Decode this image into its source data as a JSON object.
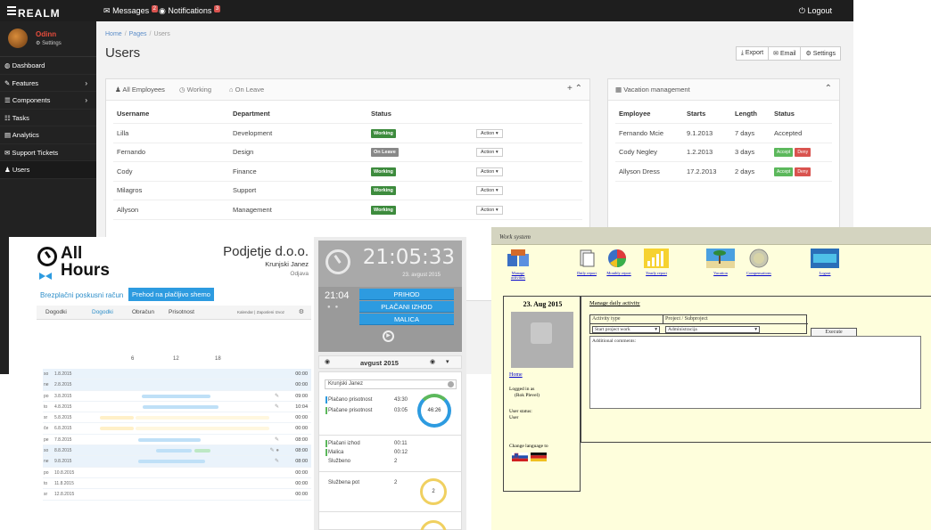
{
  "realm": {
    "brand": "REALM",
    "topbar": {
      "messages_label": "Messages",
      "messages_count": "2",
      "notifications_label": "Notifications",
      "notifications_count": "3",
      "logout_label": "Logout"
    },
    "user": {
      "name": "Odinn",
      "settings_label": "Settings"
    },
    "sidebar": [
      {
        "label": "Dashboard",
        "icon": "dashboard-icon",
        "has_children": false
      },
      {
        "label": "Features",
        "icon": "magic-icon",
        "has_children": true
      },
      {
        "label": "Components",
        "icon": "list-icon",
        "has_children": true
      },
      {
        "label": "Tasks",
        "icon": "tasks-icon",
        "has_children": false
      },
      {
        "label": "Analytics",
        "icon": "chart-icon",
        "has_children": false
      },
      {
        "label": "Support Tickets",
        "icon": "ticket-icon",
        "has_children": false
      },
      {
        "label": "Users",
        "icon": "user-icon",
        "has_children": false,
        "active": true
      }
    ],
    "breadcrumb": [
      "Home",
      "Pages",
      "Users"
    ],
    "page_title": "Users",
    "actions": {
      "export": "Export",
      "email": "Email",
      "settings": "Settings"
    },
    "employees_panel": {
      "tabs": [
        "All Employees",
        "Working",
        "On Leave"
      ],
      "columns": [
        "Username",
        "Department",
        "Status"
      ],
      "action_label": "Action",
      "rows": [
        {
          "username": "Lilla",
          "department": "Development",
          "status": "Working"
        },
        {
          "username": "Fernando",
          "department": "Design",
          "status": "On Leave"
        },
        {
          "username": "Cody",
          "department": "Finance",
          "status": "Working"
        },
        {
          "username": "Milagros",
          "department": "Support",
          "status": "Working"
        },
        {
          "username": "Allyson",
          "department": "Management",
          "status": "Working"
        }
      ]
    },
    "vacation_panel": {
      "title": "Vacation management",
      "columns": [
        "Employee",
        "Starts",
        "Length",
        "Status"
      ],
      "accept_label": "Accept",
      "deny_label": "Deny",
      "rows": [
        {
          "employee": "Fernando Mcie",
          "starts": "9.1.2013",
          "length": "7 days",
          "status": "Accepted"
        },
        {
          "employee": "Cody Negley",
          "starts": "1.2.2013",
          "length": "3 days",
          "status": ""
        },
        {
          "employee": "Allyson Dress",
          "starts": "17.2.2013",
          "length": "2 days",
          "status": ""
        }
      ]
    },
    "colors": {
      "topbar": "#1e1e1e",
      "sidebar": "#222222",
      "working": "#3d8b3d",
      "onleave": "#888888",
      "accept": "#5cb85c",
      "deny": "#d9534f",
      "link": "#5b8dc9"
    }
  },
  "allhours": {
    "logo_line1": "All",
    "logo_line2": "Hours",
    "company": "Podjetje d.o.o.",
    "person": "Krunjski Janez",
    "location": "Odjava",
    "trial_text": "Brezplačni poskusni račun",
    "trial_button": "Prehod na plačljivo shemo",
    "tabs": [
      "Dogodki",
      "Dogodki",
      "Obračun",
      "Prisotnost"
    ],
    "tab_tools": "Kalendar | Zaposleni Izvoz",
    "ruler": [
      "6",
      "12",
      "18"
    ],
    "days": [
      {
        "d": "so",
        "date": "1.8.2015",
        "time": "00:00",
        "hl": true
      },
      {
        "d": "ne",
        "date": "2.8.2015",
        "time": "00:00",
        "hl": true
      },
      {
        "d": "po",
        "date": "3.8.2015",
        "time": "09:00",
        "hl": false
      },
      {
        "d": "to",
        "date": "4.8.2015",
        "time": "10:04",
        "hl": false
      },
      {
        "d": "sr",
        "date": "5.8.2015",
        "time": "00:00",
        "hl": false
      },
      {
        "d": "če",
        "date": "6.8.2015",
        "time": "00:00",
        "hl": false
      },
      {
        "d": "pe",
        "date": "7.8.2015",
        "time": "08:00",
        "hl": false
      },
      {
        "d": "so",
        "date": "8.8.2015",
        "time": "08:00",
        "hl": true
      },
      {
        "d": "ne",
        "date": "9.8.2015",
        "time": "08:00",
        "hl": true
      },
      {
        "d": "po",
        "date": "10.8.2015",
        "time": "00:00",
        "hl": false
      },
      {
        "d": "to",
        "date": "11.8.2015",
        "time": "00:00",
        "hl": false
      },
      {
        "d": "sr",
        "date": "12.8.2015",
        "time": "00:00",
        "hl": false
      }
    ],
    "clock": {
      "time": "21:05:33",
      "date": "23. avgust 2015",
      "small_time": "21:04"
    },
    "status_buttons": [
      "PRIHOD",
      "PLAČANI IZHOD",
      "MALICA"
    ],
    "calendar_month": "avgust 2015",
    "stats": {
      "employee": "Krunjski Janez",
      "lines": [
        {
          "label": "Plačano prisotnost",
          "value": "43:30",
          "color": "#2d9be0"
        },
        {
          "label": "Plačane prisotnost",
          "value": "03:05",
          "color": "#5cb85c"
        },
        {
          "label": "Plačani izhod",
          "value": "00:11",
          "color": "#5cb85c"
        },
        {
          "label": "Malica",
          "value": "00:12",
          "color": "#5cb85c"
        },
        {
          "label": "Službeno",
          "value": "2",
          "color": "#ffffff"
        },
        {
          "label": "Službena pot",
          "value": "2",
          "color": "#f0c040"
        }
      ],
      "ring_total": "46:26",
      "ring_small": "2"
    },
    "colors": {
      "accent": "#2d9be0",
      "panel": "#a9a9a9"
    }
  },
  "work": {
    "title": "Work system",
    "toolbar": [
      {
        "label": "Manage activities",
        "icon": "book-icon"
      },
      {
        "label": "Daily report",
        "icon": "report-icon"
      },
      {
        "label": "Monthly report",
        "icon": "pie-chart-icon"
      },
      {
        "label": "Yearly report",
        "icon": "bar-chart-icon"
      },
      {
        "label": "Vacation",
        "icon": "beach-icon"
      },
      {
        "label": "Compensations",
        "icon": "coin-icon"
      },
      {
        "label": "Logout",
        "icon": "exit-icon"
      }
    ],
    "date": "23. Aug 2015",
    "home_link": "Home",
    "logged_in_label": "Logged in as",
    "logged_in_user": "(Rok Plevel)",
    "user_status_label": "User status:",
    "user_status_value": "User",
    "change_language": "Change language to",
    "heading": "Manage daily activity",
    "col_activity": "Activity type",
    "col_project": "Project / Subproject",
    "activity_value": "Start project work",
    "project_value": "Administracija",
    "execute_label": "Execute",
    "comments_label": "Additional comments:",
    "colors": {
      "background": "#fefedc",
      "link": "#0000cc"
    }
  }
}
